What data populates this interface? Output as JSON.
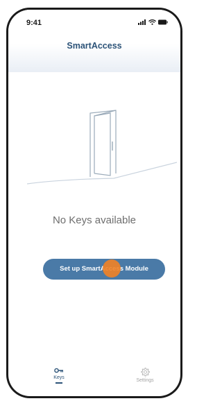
{
  "status_bar": {
    "time": "9:41"
  },
  "header": {
    "title": "SmartAccess"
  },
  "main": {
    "empty_state_text": "No Keys available",
    "setup_button_label": "Set up SmartAccess Module"
  },
  "tabbar": {
    "tabs": [
      {
        "label": "Keys",
        "icon": "key-icon",
        "selected": true
      },
      {
        "label": "Settings",
        "icon": "gear-icon",
        "selected": false
      }
    ]
  },
  "colors": {
    "brand": "#2c5378",
    "button": "#4a7aa7",
    "touch_indicator": "#f28226",
    "inactive_tab": "#a3a3a3"
  }
}
